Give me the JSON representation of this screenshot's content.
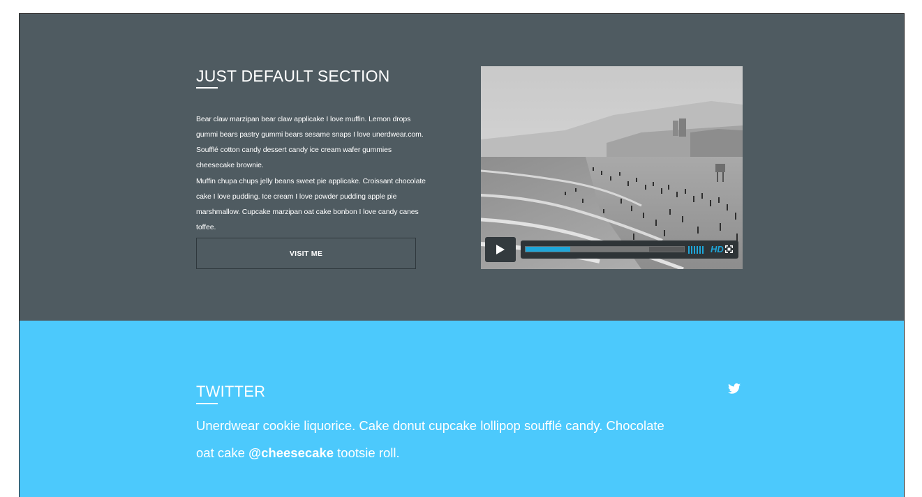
{
  "default_section": {
    "title": "JUST DEFAULT SECTION",
    "paragraph_1": "Bear claw marzipan bear claw applicake I love muffin. Lemon drops gummi bears pastry gummi bears sesame snaps I love unerdwear.com. Soufflé cotton candy dessert candy ice cream wafer gummies cheesecake brownie.",
    "paragraph_2": "Muffin chupa chups jelly beans sweet pie applicake. Croissant chocolate cake I love pudding. Ice cream I love powder pudding apple pie marshmallow. Cupcake marzipan oat cake bonbon I love candy canes toffee.",
    "button_label": "VISIT ME",
    "background_color": "#4f5b61"
  },
  "video_player": {
    "progress": 0.28,
    "buffered": 0.78,
    "hd_label": "HD",
    "icons": [
      "play-icon",
      "volume-icon",
      "fullscreen-icon"
    ],
    "accent_color": "#1ea6d9"
  },
  "twitter_section": {
    "title": "TWITTER",
    "tweet_text_before": "Unerdwear cookie liquorice. Cake donut cupcake lollipop soufflé candy. Chocolate oat cake ",
    "tweet_handle": "@cheesecake",
    "tweet_text_after": " tootsie roll.",
    "icon": "twitter-bird-icon",
    "background_color": "#4cc9fc"
  }
}
